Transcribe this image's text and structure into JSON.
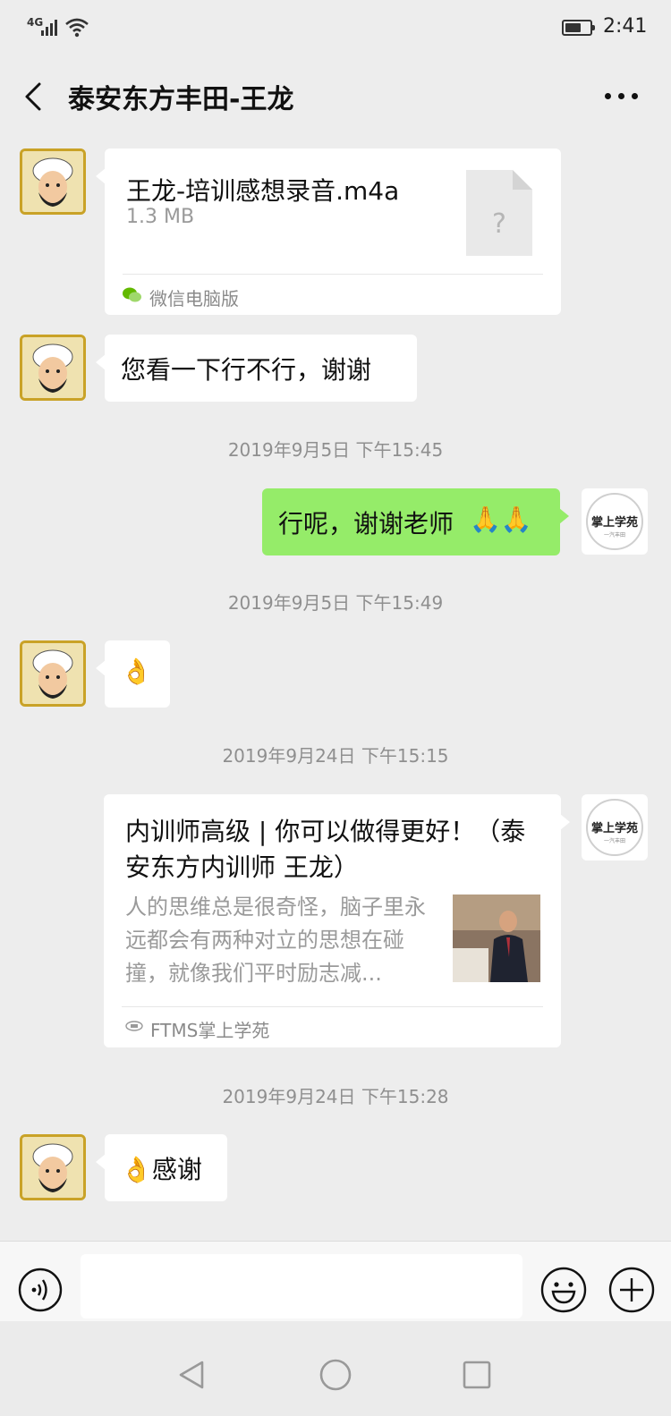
{
  "status_bar": {
    "network": "4G",
    "time": "2:41",
    "battery_level": 0.65
  },
  "chat": {
    "title": "泰安东方丰田-王龙"
  },
  "messages": {
    "file": {
      "name": "王龙-培训感想录音.m4a",
      "size": "1.3 MB",
      "source": "微信电脑版",
      "icon_glyph": "?"
    },
    "text1": "您看一下行不行，谢谢",
    "ts1": "2019年9月5日 下午15:45",
    "reply1": "行呢，谢谢老师",
    "reply1_emoji": "🙏🙏",
    "ts2": "2019年9月5日 下午15:49",
    "text2": "👌",
    "ts3": "2019年9月24日 下午15:15",
    "article": {
      "title": "内训师高级 | 你可以做得更好！（泰安东方内训师 王龙）",
      "description": "人的思维总是很奇怪，脑子里永远都会有两种对立的思想在碰撞，就像我们平时励志减...",
      "source": "FTMS掌上学苑"
    },
    "ts4": "2019年9月24日 下午15:28",
    "text3": "👌感谢"
  },
  "self_avatar": {
    "name": "掌上学苑",
    "sub": "一汽丰田"
  },
  "colors": {
    "self_bubble": "#95ec69",
    "background": "#ededed",
    "bubble": "#ffffff"
  }
}
